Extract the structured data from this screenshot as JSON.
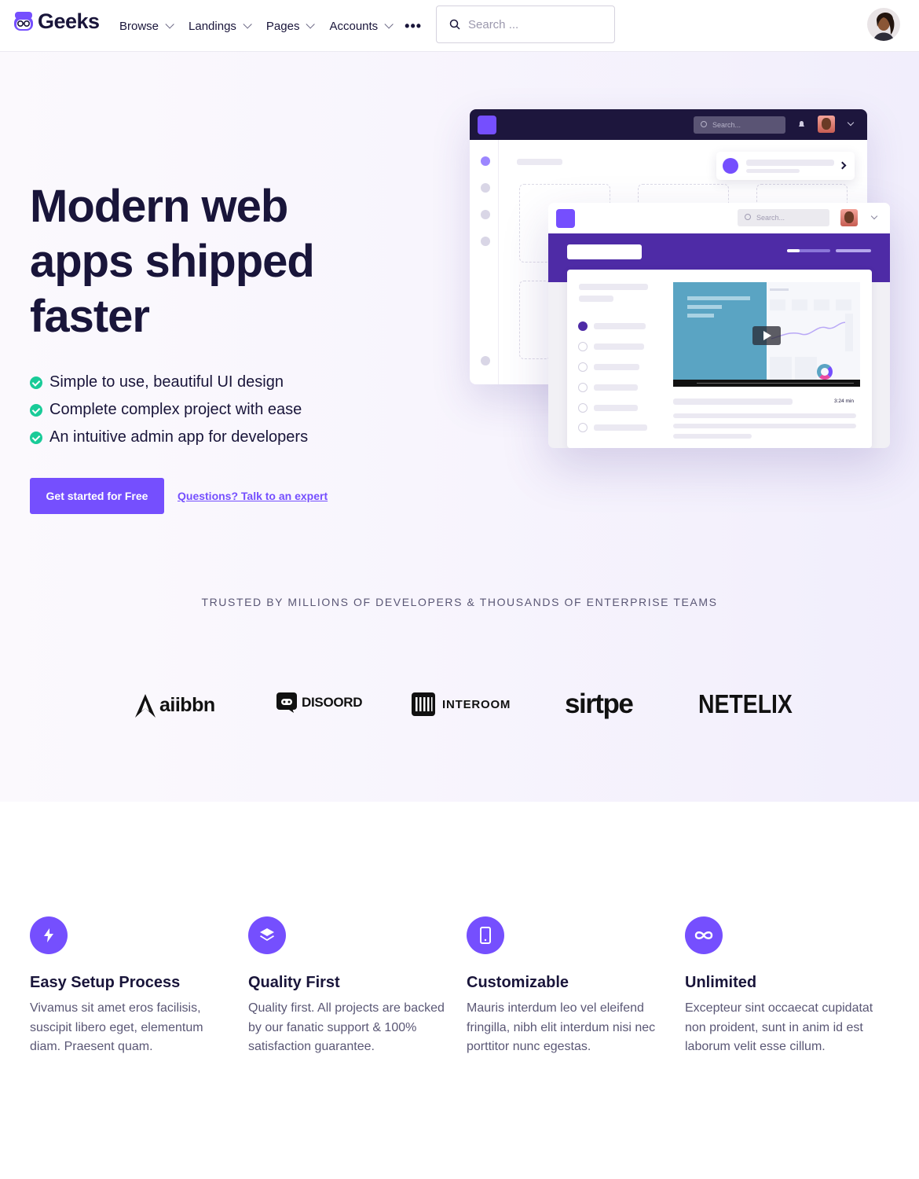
{
  "nav": {
    "brand": "Geeks",
    "menu": [
      "Browse",
      "Landings",
      "Pages",
      "Accounts"
    ],
    "more_icon": "ellipsis-icon",
    "search_placeholder": "Search ...",
    "avatar": "user-avatar"
  },
  "hero": {
    "title": "Modern web apps shipped faster",
    "checks": [
      "Simple to use, beautiful UI design",
      "Complete complex project with ease",
      "An intuitive admin app for developers"
    ],
    "cta_label": "Get started for Free",
    "expert_link": "Questions? Talk to an expert",
    "mockup": {
      "search_back": "Search...",
      "search_front": "Search...",
      "video_time": "3:24 min"
    }
  },
  "trusted": {
    "heading": "TRUSTED BY MILLIONS OF DEVELOPERS & THOUSANDS OF ENTERPRISE TEAMS",
    "logos": [
      "aiibbn",
      "DISOORD",
      "INTEROOM",
      "sirtpe",
      "NETELIX"
    ]
  },
  "features": [
    {
      "icon": "lightning-icon",
      "title": "Easy Setup Process",
      "text": "Vivamus sit amet eros facilisis, suscipit libero eget, elementum diam. Praesent quam."
    },
    {
      "icon": "layers-icon",
      "title": "Quality First",
      "text": "Quality first. All projects are backed by our fanatic support & 100% satisfaction guarantee."
    },
    {
      "icon": "smartphone-icon",
      "title": "Customizable",
      "text": "Mauris interdum leo vel eleifend fringilla, nibh elit interdum nisi nec porttitor nunc egestas."
    },
    {
      "icon": "infinity-icon",
      "title": "Unlimited",
      "text": "Excepteur sint occaecat cupidatat non proident, sunt in anim id est laborum velit esse cillum."
    }
  ],
  "colors": {
    "primary": "#754ffe",
    "dark": "#19153a",
    "success": "#19cb98",
    "muted": "#5a5775"
  }
}
